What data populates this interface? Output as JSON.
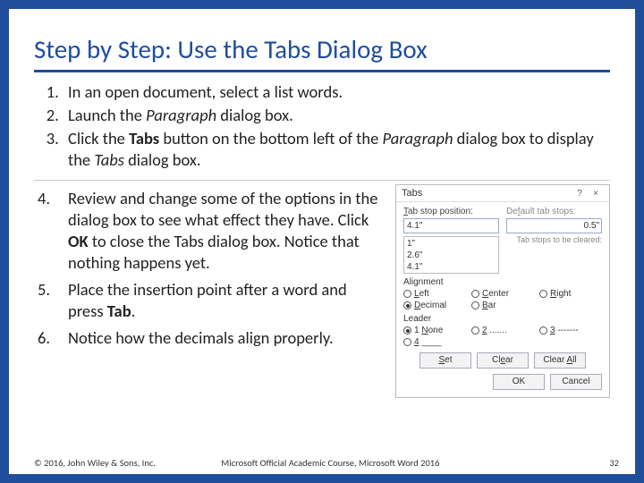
{
  "title": "Step by Step: Use the Tabs Dialog Box",
  "steps_top": [
    {
      "pre": "In an open document, select a list words.",
      "b": "",
      "post": ""
    },
    {
      "pre": "Launch the ",
      "i": "Paragraph",
      "post": " dialog box."
    },
    {
      "pre": "Click the ",
      "b": "Tabs",
      "mid": " button on the bottom left of the ",
      "i": "Paragraph",
      "post": " dialog box to display the ",
      "i2": "Tabs",
      "end": " dialog box."
    }
  ],
  "steps_bottom": [
    {
      "pre": "Review and change some of the options in the dialog box to see what effect they have. Click ",
      "b": "OK",
      "post": " to close the Tabs dialog box. Notice that nothing happens yet."
    },
    {
      "pre": "Place the insertion point after a word and press ",
      "b": "Tab",
      "post": "."
    },
    {
      "pre": "Notice how the decimals align properly.",
      "b": "",
      "post": ""
    }
  ],
  "dialog": {
    "title": "Tabs",
    "help": "?",
    "close": "×",
    "tabstop_label": "Tab stop position:",
    "tabstop_value": "4.1\"",
    "default_label": "Default tab stops:",
    "default_value": "0.5\"",
    "list": [
      "1\"",
      "2.6\"",
      "4.1\""
    ],
    "clear_label": "Tab stops to be cleared:",
    "alignment_label": "Alignment",
    "alignments": [
      {
        "u": "L",
        "rest": "eft",
        "on": false
      },
      {
        "u": "C",
        "rest": "enter",
        "on": false
      },
      {
        "u": "R",
        "rest": "ight",
        "on": false
      },
      {
        "u": "D",
        "rest": "ecimal",
        "on": true
      },
      {
        "u": "B",
        "rest": "ar",
        "on": false
      }
    ],
    "leader_label": "Leader",
    "leaders": [
      {
        "label": "1 ",
        "u": "N",
        "rest": "one",
        "on": true
      },
      {
        "label": "",
        "u": "2",
        "rest": " .......",
        "on": false
      },
      {
        "label": "",
        "u": "3",
        "rest": " -------",
        "on": false
      },
      {
        "label": "",
        "u": "4",
        "rest": " ____",
        "on": false
      }
    ],
    "buttons": {
      "set": "Set",
      "clear": "Clear",
      "clearall": "Clear All",
      "ok": "OK",
      "cancel": "Cancel"
    }
  },
  "footer": {
    "copyright": "© 2016, John Wiley & Sons, Inc.",
    "course": "Microsoft Official Academic Course, Microsoft Word 2016",
    "page": "32"
  }
}
